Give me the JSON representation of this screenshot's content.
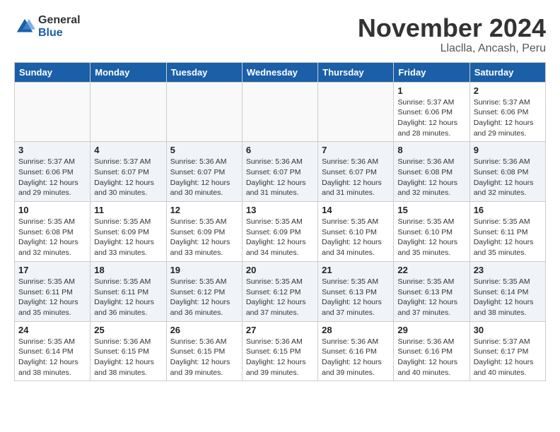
{
  "logo": {
    "general": "General",
    "blue": "Blue"
  },
  "header": {
    "month": "November 2024",
    "location": "Llaclla, Ancash, Peru"
  },
  "weekdays": [
    "Sunday",
    "Monday",
    "Tuesday",
    "Wednesday",
    "Thursday",
    "Friday",
    "Saturday"
  ],
  "weeks": [
    [
      {
        "day": "",
        "info": ""
      },
      {
        "day": "",
        "info": ""
      },
      {
        "day": "",
        "info": ""
      },
      {
        "day": "",
        "info": ""
      },
      {
        "day": "",
        "info": ""
      },
      {
        "day": "1",
        "info": "Sunrise: 5:37 AM\nSunset: 6:06 PM\nDaylight: 12 hours\nand 28 minutes."
      },
      {
        "day": "2",
        "info": "Sunrise: 5:37 AM\nSunset: 6:06 PM\nDaylight: 12 hours\nand 29 minutes."
      }
    ],
    [
      {
        "day": "3",
        "info": "Sunrise: 5:37 AM\nSunset: 6:06 PM\nDaylight: 12 hours\nand 29 minutes."
      },
      {
        "day": "4",
        "info": "Sunrise: 5:37 AM\nSunset: 6:07 PM\nDaylight: 12 hours\nand 30 minutes."
      },
      {
        "day": "5",
        "info": "Sunrise: 5:36 AM\nSunset: 6:07 PM\nDaylight: 12 hours\nand 30 minutes."
      },
      {
        "day": "6",
        "info": "Sunrise: 5:36 AM\nSunset: 6:07 PM\nDaylight: 12 hours\nand 31 minutes."
      },
      {
        "day": "7",
        "info": "Sunrise: 5:36 AM\nSunset: 6:07 PM\nDaylight: 12 hours\nand 31 minutes."
      },
      {
        "day": "8",
        "info": "Sunrise: 5:36 AM\nSunset: 6:08 PM\nDaylight: 12 hours\nand 32 minutes."
      },
      {
        "day": "9",
        "info": "Sunrise: 5:36 AM\nSunset: 6:08 PM\nDaylight: 12 hours\nand 32 minutes."
      }
    ],
    [
      {
        "day": "10",
        "info": "Sunrise: 5:35 AM\nSunset: 6:08 PM\nDaylight: 12 hours\nand 32 minutes."
      },
      {
        "day": "11",
        "info": "Sunrise: 5:35 AM\nSunset: 6:09 PM\nDaylight: 12 hours\nand 33 minutes."
      },
      {
        "day": "12",
        "info": "Sunrise: 5:35 AM\nSunset: 6:09 PM\nDaylight: 12 hours\nand 33 minutes."
      },
      {
        "day": "13",
        "info": "Sunrise: 5:35 AM\nSunset: 6:09 PM\nDaylight: 12 hours\nand 34 minutes."
      },
      {
        "day": "14",
        "info": "Sunrise: 5:35 AM\nSunset: 6:10 PM\nDaylight: 12 hours\nand 34 minutes."
      },
      {
        "day": "15",
        "info": "Sunrise: 5:35 AM\nSunset: 6:10 PM\nDaylight: 12 hours\nand 35 minutes."
      },
      {
        "day": "16",
        "info": "Sunrise: 5:35 AM\nSunset: 6:11 PM\nDaylight: 12 hours\nand 35 minutes."
      }
    ],
    [
      {
        "day": "17",
        "info": "Sunrise: 5:35 AM\nSunset: 6:11 PM\nDaylight: 12 hours\nand 35 minutes."
      },
      {
        "day": "18",
        "info": "Sunrise: 5:35 AM\nSunset: 6:11 PM\nDaylight: 12 hours\nand 36 minutes."
      },
      {
        "day": "19",
        "info": "Sunrise: 5:35 AM\nSunset: 6:12 PM\nDaylight: 12 hours\nand 36 minutes."
      },
      {
        "day": "20",
        "info": "Sunrise: 5:35 AM\nSunset: 6:12 PM\nDaylight: 12 hours\nand 37 minutes."
      },
      {
        "day": "21",
        "info": "Sunrise: 5:35 AM\nSunset: 6:13 PM\nDaylight: 12 hours\nand 37 minutes."
      },
      {
        "day": "22",
        "info": "Sunrise: 5:35 AM\nSunset: 6:13 PM\nDaylight: 12 hours\nand 37 minutes."
      },
      {
        "day": "23",
        "info": "Sunrise: 5:35 AM\nSunset: 6:14 PM\nDaylight: 12 hours\nand 38 minutes."
      }
    ],
    [
      {
        "day": "24",
        "info": "Sunrise: 5:35 AM\nSunset: 6:14 PM\nDaylight: 12 hours\nand 38 minutes."
      },
      {
        "day": "25",
        "info": "Sunrise: 5:36 AM\nSunset: 6:15 PM\nDaylight: 12 hours\nand 38 minutes."
      },
      {
        "day": "26",
        "info": "Sunrise: 5:36 AM\nSunset: 6:15 PM\nDaylight: 12 hours\nand 39 minutes."
      },
      {
        "day": "27",
        "info": "Sunrise: 5:36 AM\nSunset: 6:15 PM\nDaylight: 12 hours\nand 39 minutes."
      },
      {
        "day": "28",
        "info": "Sunrise: 5:36 AM\nSunset: 6:16 PM\nDaylight: 12 hours\nand 39 minutes."
      },
      {
        "day": "29",
        "info": "Sunrise: 5:36 AM\nSunset: 6:16 PM\nDaylight: 12 hours\nand 40 minutes."
      },
      {
        "day": "30",
        "info": "Sunrise: 5:37 AM\nSunset: 6:17 PM\nDaylight: 12 hours\nand 40 minutes."
      }
    ]
  ]
}
